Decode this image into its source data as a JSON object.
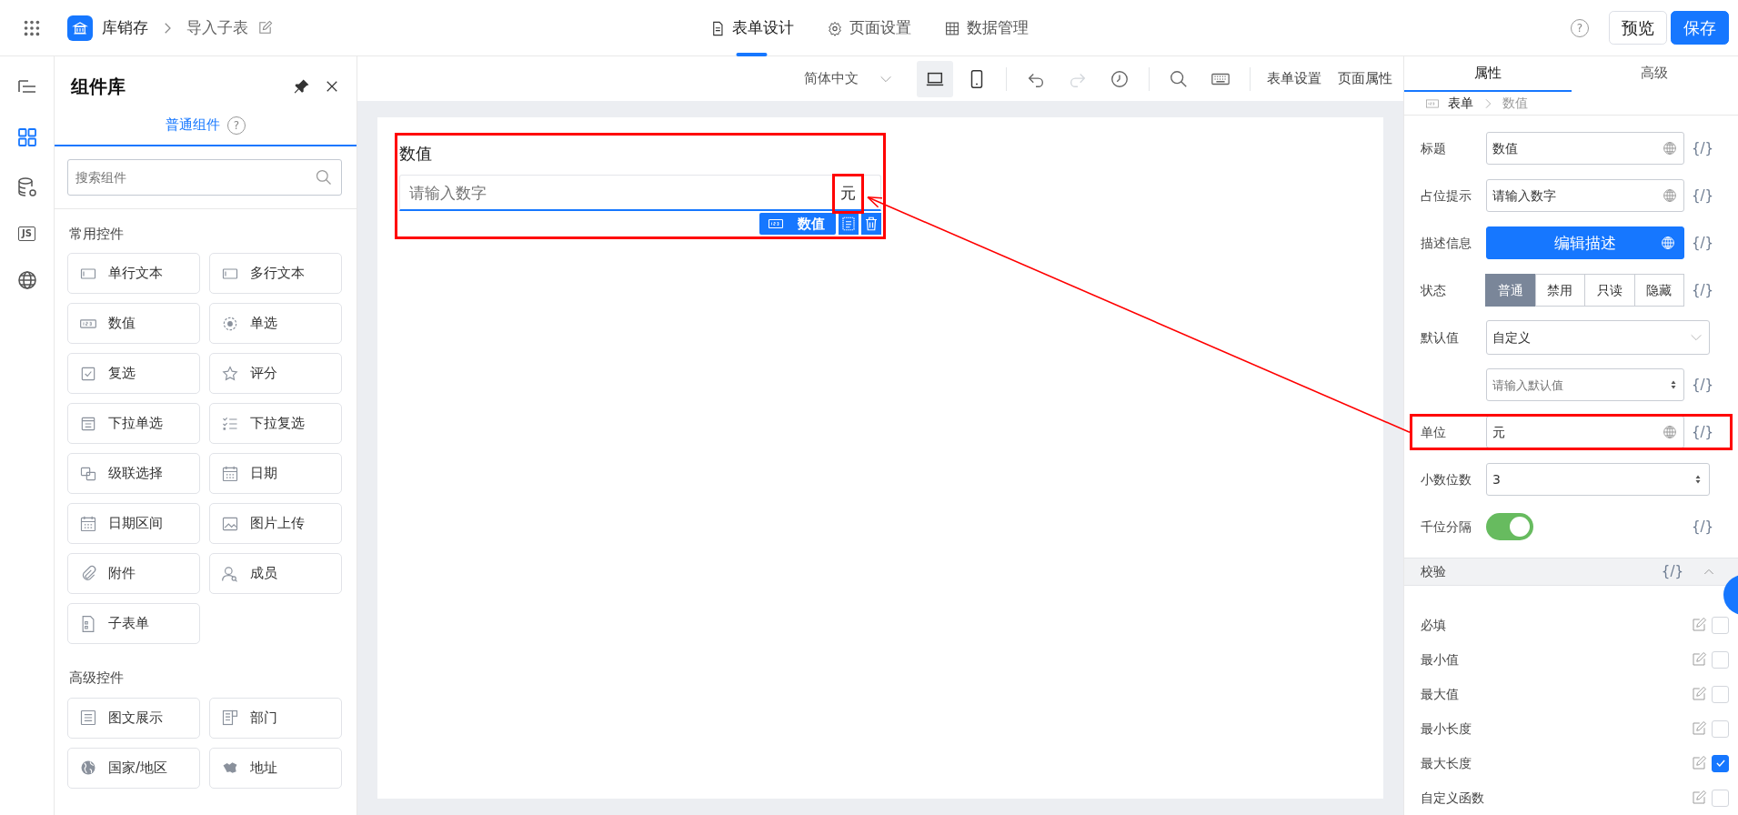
{
  "topbar": {
    "app_name": "库销存",
    "page_name": "导入子表",
    "tabs": [
      {
        "label": "表单设计",
        "kind": "doc",
        "selected": true
      },
      {
        "label": "页面设置",
        "kind": "gear",
        "selected": false
      },
      {
        "label": "数据管理",
        "kind": "table",
        "selected": false
      }
    ],
    "help": "?",
    "buttons": [
      {
        "label": "预览",
        "kind": "outline"
      },
      {
        "label": "保存",
        "kind": "primary"
      }
    ]
  },
  "rail": [
    {
      "kind": "outline",
      "selected": false
    },
    {
      "kind": "components",
      "selected": true
    },
    {
      "kind": "data",
      "selected": false
    },
    {
      "kind": "script",
      "label": "JS",
      "selected": false
    },
    {
      "kind": "language",
      "selected": false
    }
  ],
  "library": {
    "title": "组件库",
    "tabs": [
      {
        "label": "普通组件",
        "selected": true
      }
    ],
    "help": "?",
    "search": {
      "placeholder": "搜索组件"
    },
    "groups": [
      {
        "title": "常用控件",
        "items": [
          {
            "label": "单行文本",
            "kind": "text"
          },
          {
            "label": "多行文本",
            "kind": "text"
          },
          {
            "label": "数值",
            "kind": "number"
          },
          {
            "label": "单选",
            "kind": "radio"
          },
          {
            "label": "复选",
            "kind": "checkbox"
          },
          {
            "label": "评分",
            "kind": "star"
          },
          {
            "label": "下拉单选",
            "kind": "select"
          },
          {
            "label": "下拉复选",
            "kind": "multiselect"
          },
          {
            "label": "级联选择",
            "kind": "cascade"
          },
          {
            "label": "日期",
            "kind": "date"
          },
          {
            "label": "日期区间",
            "kind": "date"
          },
          {
            "label": "图片上传",
            "kind": "image"
          },
          {
            "label": "附件",
            "kind": "clip"
          },
          {
            "label": "成员",
            "kind": "member"
          },
          {
            "label": "子表单",
            "kind": "file"
          }
        ]
      },
      {
        "title": "高级控件",
        "items": [
          {
            "label": "图文展示",
            "kind": "lines"
          },
          {
            "label": "部门",
            "kind": "dept"
          },
          {
            "label": "国家/地区",
            "kind": "globe"
          },
          {
            "label": "地址",
            "kind": "map"
          }
        ]
      }
    ]
  },
  "toolbar": {
    "language": "简体中文",
    "devices": [
      {
        "kind": "desktop",
        "selected": true
      },
      {
        "kind": "mobile",
        "selected": false
      }
    ],
    "tools": [
      {
        "kind": "undo",
        "disabled": false
      },
      {
        "kind": "redo",
        "disabled": true
      },
      {
        "kind": "history",
        "disabled": false
      },
      {
        "kind": "search",
        "disabled": false
      },
      {
        "kind": "keyboard",
        "disabled": false
      }
    ],
    "links": [
      "表单设置",
      "页面属性"
    ]
  },
  "canvas": {
    "field": {
      "label": "数值",
      "placeholder": "请输入数字",
      "unit": "元",
      "tag": "数值"
    }
  },
  "properties": {
    "tabs": [
      {
        "label": "属性",
        "selected": true
      },
      {
        "label": "高级",
        "selected": false
      }
    ],
    "breadcrumb": [
      "表单",
      "数值"
    ],
    "rows": [
      {
        "kind": "input",
        "label": "标题",
        "value": "数值",
        "expr": "{/}"
      },
      {
        "kind": "input",
        "label": "占位提示",
        "value": "请输入数字",
        "expr": "{/}"
      },
      {
        "kind": "button",
        "label": "描述信息",
        "value": "编辑描述",
        "expr": "{/}"
      },
      {
        "kind": "segmented",
        "label": "状态",
        "options": [
          {
            "label": "普通",
            "selected": true
          },
          {
            "label": "禁用",
            "selected": false
          },
          {
            "label": "只读",
            "selected": false
          },
          {
            "label": "隐藏",
            "selected": false
          }
        ],
        "expr": "{/}"
      },
      {
        "kind": "select",
        "label": "默认值",
        "value": "自定义"
      },
      {
        "kind": "number",
        "placeholder": "请输入默认值",
        "expr": "{/}"
      },
      {
        "kind": "input",
        "label": "单位",
        "value": "元",
        "expr": "{/}"
      },
      {
        "kind": "number",
        "label": "小数位数",
        "value": "3"
      },
      {
        "kind": "switch",
        "label": "千位分隔",
        "on": true,
        "expr": "{/}"
      }
    ],
    "validation": {
      "title": "校验",
      "expr": "{/}",
      "expanded": true,
      "rules": [
        {
          "label": "必填",
          "checked": false
        },
        {
          "label": "最小值",
          "checked": false
        },
        {
          "label": "最大值",
          "checked": false
        },
        {
          "label": "最小长度",
          "checked": false
        },
        {
          "label": "最大长度",
          "checked": true
        },
        {
          "label": "自定义函数",
          "checked": false
        }
      ]
    }
  }
}
